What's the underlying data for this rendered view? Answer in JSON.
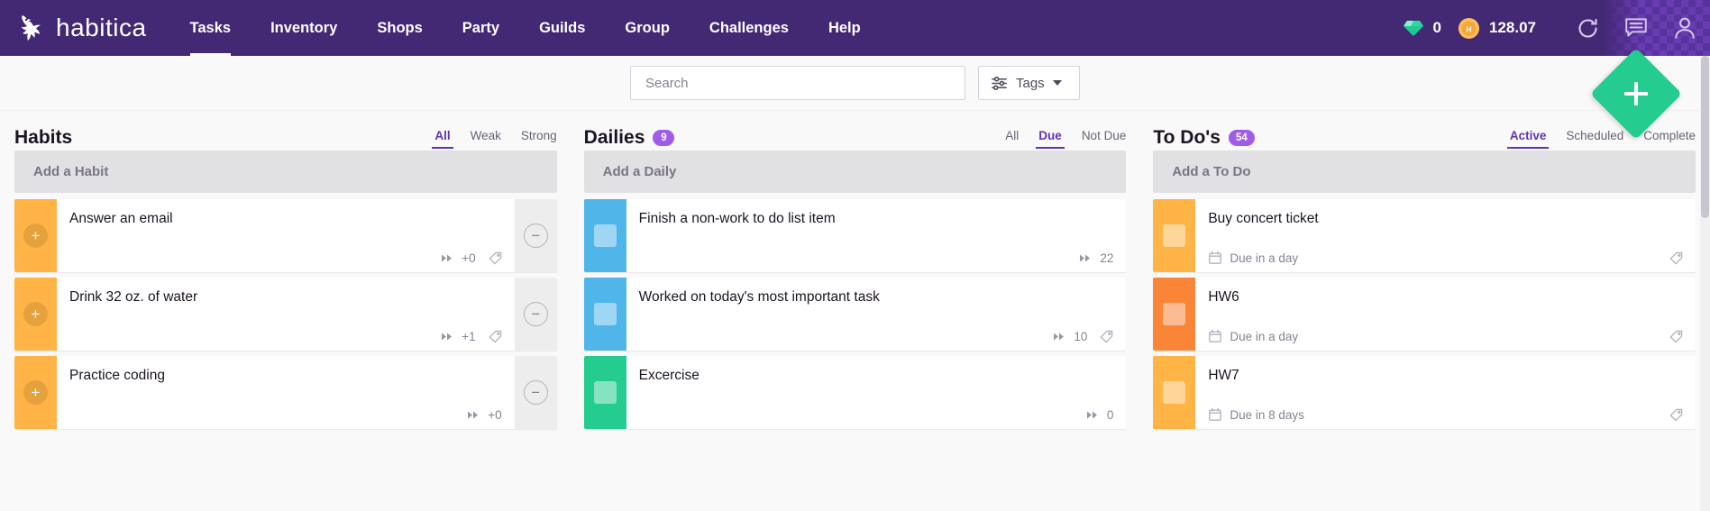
{
  "header": {
    "brand": "habitica",
    "logo_icon": "gryphon-logo-icon",
    "nav": [
      {
        "label": "Tasks",
        "active": true
      },
      {
        "label": "Inventory",
        "active": false
      },
      {
        "label": "Shops",
        "active": false
      },
      {
        "label": "Party",
        "active": false
      },
      {
        "label": "Guilds",
        "active": false
      },
      {
        "label": "Group",
        "active": false
      },
      {
        "label": "Challenges",
        "active": false
      },
      {
        "label": "Help",
        "active": false
      }
    ],
    "gems": "0",
    "gold": "128.07",
    "gem_icon": "gem-icon",
    "coin_icon": "gold-coin-icon",
    "sync_icon": "refresh-sync-icon",
    "messages_icon": "chat-bubble-icon",
    "user_icon": "user-avatar-icon"
  },
  "toolbar": {
    "search_placeholder": "Search",
    "search_value": "",
    "tags_label": "Tags",
    "tags_icon": "filter-sliders-icon",
    "caret_icon": "chevron-down-icon",
    "add_task_label": "+",
    "add_task_icon": "plus-icon"
  },
  "columns": [
    {
      "key": "habits",
      "title": "Habits",
      "badge": null,
      "filters": [
        {
          "label": "All",
          "active": true
        },
        {
          "label": "Weak",
          "active": false
        },
        {
          "label": "Strong",
          "active": false
        }
      ],
      "add_label": "Add a Habit",
      "tasks": [
        {
          "title": "Answer an email",
          "color": "#ffb445",
          "left_icon": "plus-icon",
          "right_icon": "minus-icon",
          "counter_icon": "streak-arrows-icon",
          "counter": "+0",
          "tag_icon": "tag-icon",
          "has_tag": true
        },
        {
          "title": "Drink 32 oz. of water",
          "color": "#ffb445",
          "left_icon": "plus-icon",
          "right_icon": "minus-icon",
          "counter_icon": "streak-arrows-icon",
          "counter": "+1",
          "tag_icon": "tag-icon",
          "has_tag": true
        },
        {
          "title": "Practice coding",
          "color": "#ffb445",
          "left_icon": "plus-icon",
          "right_icon": "minus-icon",
          "counter_icon": "streak-arrows-icon",
          "counter": "+0",
          "tag_icon": "tag-icon",
          "has_tag": false
        }
      ]
    },
    {
      "key": "dailies",
      "title": "Dailies",
      "badge": "9",
      "filters": [
        {
          "label": "All",
          "active": false
        },
        {
          "label": "Due",
          "active": true
        },
        {
          "label": "Not Due",
          "active": false
        }
      ],
      "add_label": "Add a Daily",
      "tasks": [
        {
          "title": "Finish a non-work to do list item",
          "color": "#50b5e9",
          "left_icon": "checkbox-icon",
          "counter_icon": "streak-arrows-icon",
          "counter": "22",
          "tag_icon": "tag-icon",
          "has_tag": false
        },
        {
          "title": "Worked on today's most important task",
          "color": "#50b5e9",
          "left_icon": "checkbox-icon",
          "counter_icon": "streak-arrows-icon",
          "counter": "10",
          "tag_icon": "tag-icon",
          "has_tag": true
        },
        {
          "title": "Excercise",
          "color": "#24cc8f",
          "left_icon": "checkbox-icon",
          "counter_icon": "streak-arrows-icon",
          "counter": "0",
          "tag_icon": "tag-icon",
          "has_tag": false
        }
      ]
    },
    {
      "key": "todos",
      "title": "To Do's",
      "badge": "54",
      "filters": [
        {
          "label": "Active",
          "active": true
        },
        {
          "label": "Scheduled",
          "active": false
        },
        {
          "label": "Complete",
          "active": false
        }
      ],
      "add_label": "Add a To Do",
      "tasks": [
        {
          "title": "Buy concert ticket",
          "color": "#ffb445",
          "left_icon": "checkbox-icon",
          "due_icon": "calendar-icon",
          "due": "Due in a day",
          "tag_icon": "tag-icon",
          "has_tag": true
        },
        {
          "title": "HW6",
          "color": "#fa8537",
          "left_icon": "checkbox-icon",
          "due_icon": "calendar-icon",
          "due": "Due in a day",
          "tag_icon": "tag-icon",
          "has_tag": true
        },
        {
          "title": "HW7",
          "color": "#ffb445",
          "left_icon": "checkbox-icon",
          "due_icon": "calendar-icon",
          "due": "Due in 8 days",
          "tag_icon": "tag-icon",
          "has_tag": true
        }
      ]
    }
  ]
}
